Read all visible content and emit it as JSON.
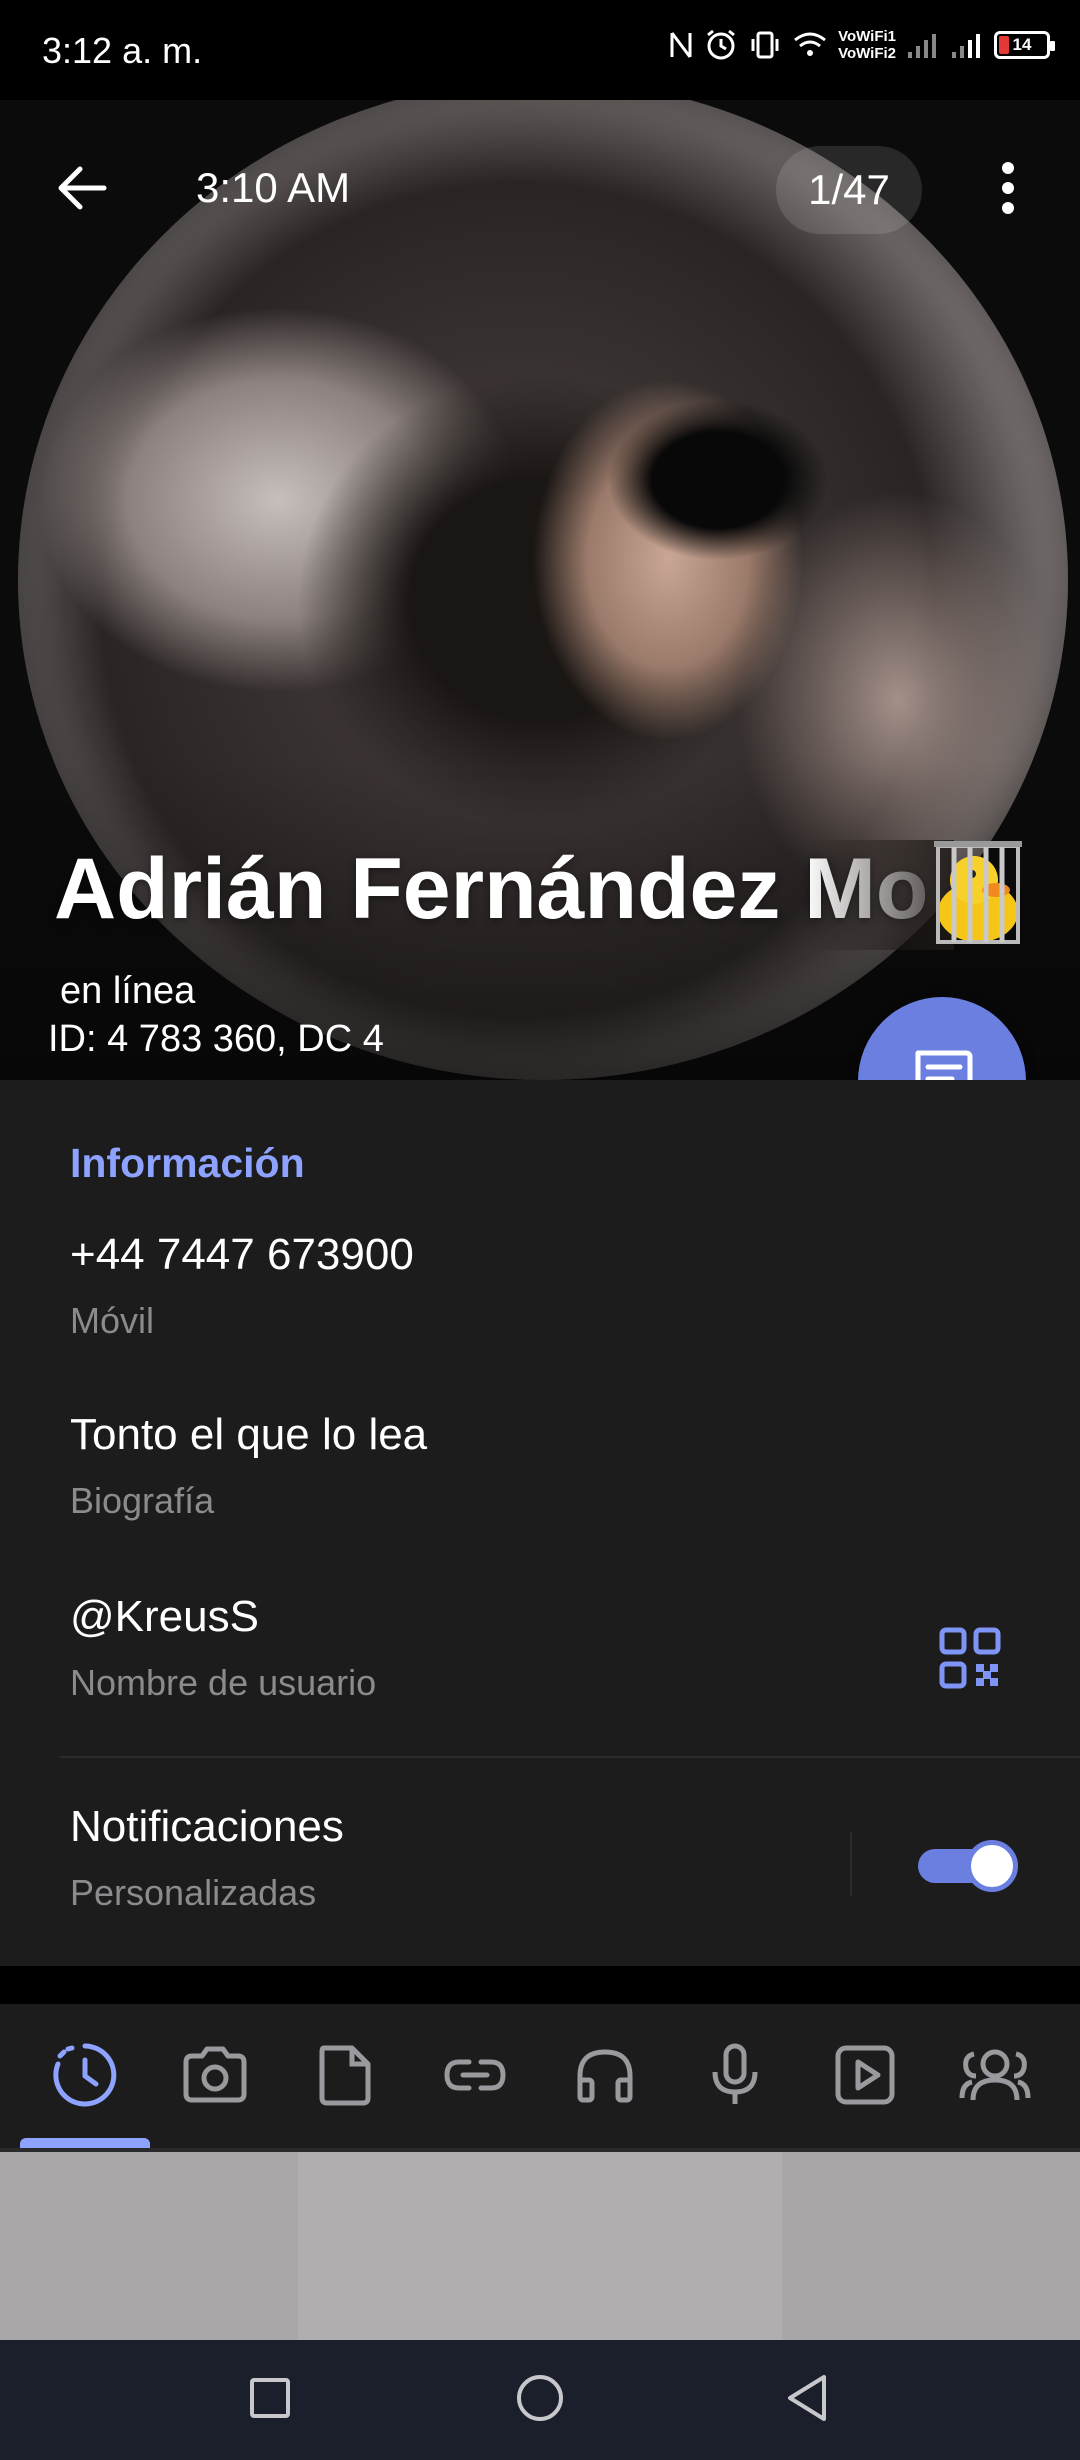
{
  "status_bar": {
    "time": "3:12 a. m.",
    "wifi_line1": "VoWiFi1",
    "wifi_line2": "VoWiFi2",
    "battery": "14",
    "icons": [
      "nfc-icon",
      "alarm-icon",
      "vibrate-icon",
      "wifi-icon",
      "signal-icon",
      "signal-icon",
      "battery-icon"
    ]
  },
  "header": {
    "photo_time": "3:10 AM",
    "photo_counter": "1/47",
    "name": "Adrián Fernández Mo",
    "status": "en línea",
    "user_id": "ID: 4 783 360, DC 4",
    "icons": [
      "back-arrow-icon",
      "more-vert-icon",
      "message-icon",
      "duck-sticker-emoji"
    ]
  },
  "info": {
    "section_title": "Información",
    "phone": "+44 7447 673900",
    "phone_label": "Móvil",
    "bio": "Tonto el que lo lea",
    "bio_label": "Biografía",
    "username": "@KreusS",
    "username_label": "Nombre de usuario",
    "notifications": "Notificaciones",
    "notifications_label": "Personalizadas",
    "notifications_enabled": true
  },
  "media_tabs": [
    "stories-icon",
    "photos-icon",
    "files-icon",
    "links-icon",
    "music-icon",
    "voice-icon",
    "gifs-icon",
    "groups-icon"
  ],
  "media_tabs_selected": 0,
  "navbar": [
    "recents-square-icon",
    "home-circle-icon",
    "back-triangle-icon"
  ],
  "colors": {
    "accent": "#6b7fe0",
    "accent_light": "#8ea3ff",
    "card_bg": "#1c1c1d",
    "secondary_text": "#8b8b8e"
  }
}
